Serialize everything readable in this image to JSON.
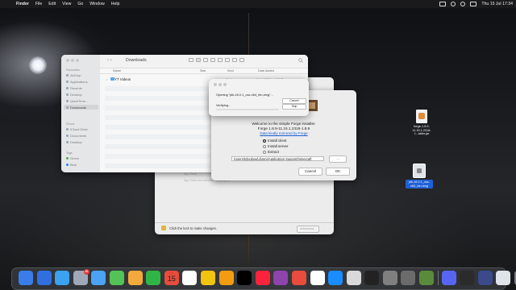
{
  "menubar": {
    "app": "Finder",
    "items": [
      "File",
      "Edit",
      "View",
      "Go",
      "Window",
      "Help"
    ],
    "clock": "Thu 15 Jul  17:34"
  },
  "desktop": {
    "forge_jar": "forge-1.8.9-11.15.1.2318-1...taller.jar",
    "jdk_dmg": "jdk-16.0.1_osx-x64_bin.dmg"
  },
  "finder": {
    "title": "Downloads",
    "sidebar": {
      "favourites_header": "Favourites",
      "items": [
        "AirDrop",
        "Applications",
        "Recents",
        "Desktop",
        "QuickTime...",
        "Downloads"
      ],
      "icloud_header": "iCloud",
      "icloud_items": [
        "iCloud Drive",
        "Documents",
        "Desktop"
      ],
      "tags_header": "Tags",
      "tags": [
        "Green",
        "Blue"
      ]
    },
    "columns": {
      "name": "Name",
      "size": "Size",
      "kind": "Kind",
      "date_added": "Date Added"
    },
    "rows": [
      {
        "name": "YT Videos",
        "kind": "Folder",
        "date": "5 Jul 2021 at 17:31"
      }
    ]
  },
  "appstore": {
    "hint1": "App Store",
    "hint2": "App Store and identified developers",
    "lock_text": "Click the lock to make changes.",
    "advanced_button": "Advanced..."
  },
  "forge": {
    "welcome": "Welcome to the simple Forge installer.",
    "version": "Forge 1.8.9-11.15.1.2318-1.8.9",
    "link": "Data kindly mirrored by Forge",
    "options": [
      "Install client",
      "Install server",
      "Extract"
    ],
    "selected_option": "Install client",
    "path": "/Users/tobydow/Library/Application Support/minecraft",
    "browse_button": "...",
    "cancel_button": "Cancel",
    "ok_button": "OK"
  },
  "verify": {
    "title": "Opening \"jdk-16.0.1_osx-x64_bin.dmg\"...",
    "status": "Verifying...",
    "cancel_button": "Cancel",
    "skip_button": "Skip"
  },
  "dock": {
    "calendar_month": "JUL",
    "calendar_day": "15",
    "messages_badge": "10",
    "app_colors": [
      "#3b7de8",
      "#2f6fe0",
      "#3aa2f0",
      "#9fa8b8",
      "#4aa3f5",
      "#54c356",
      "#f3a93c",
      "#2fb545",
      "#e74c3c",
      "#ffffff",
      "#f1c40f",
      "#f39c12",
      "#000000",
      "#fa233b",
      "#8e44ad",
      "#e74c3c",
      "#ffffff",
      "#1a8cff",
      "#d9d9d9",
      "#222222",
      "#7f7f7f",
      "#6b6b6b",
      "#5a8a3c",
      "#5865f2",
      "#2b2b2b",
      "#3a4a8a",
      "#dfe3ea",
      "#7a7d85"
    ]
  }
}
